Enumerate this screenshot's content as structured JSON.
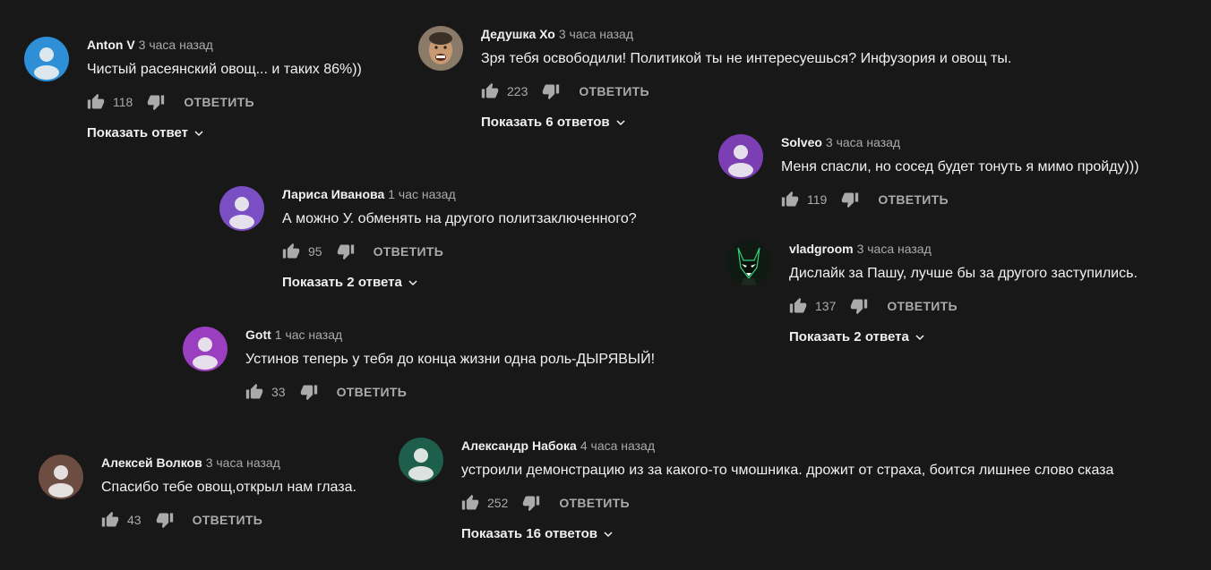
{
  "reply_label": "ОТВЕТИТЬ",
  "comments": [
    {
      "author": "Anton V",
      "time": "3 часа назад",
      "text": "Чистый расеянский овощ... и таких 86%))",
      "likes": "118",
      "show_replies": "Показать ответ",
      "avatar_icon": "person-icon",
      "avatar_color": "#2e8fd6"
    },
    {
      "author": "Дедушка Хо",
      "time": "3 часа назад",
      "text": "Зря тебя освободили! Политикой ты не интересуешься?  Инфузория и овощ ты.",
      "likes": "223",
      "show_replies": "Показать 6 ответов",
      "avatar_icon": "photo-avatar",
      "avatar_color": "#6b5a4a"
    },
    {
      "author": "Solveo",
      "time": "3 часа назад",
      "text": "Меня спасли, но сосед будет тонуть я мимо пройду)))",
      "likes": "119",
      "show_replies": "",
      "avatar_icon": "person-icon",
      "avatar_color": "#7b3fb3"
    },
    {
      "author": "Лариса Иванова",
      "time": "1 час назад",
      "text": "А можно У. обменять на другого политзаключенного?",
      "likes": "95",
      "show_replies": "Показать 2 ответа",
      "avatar_icon": "person-icon",
      "avatar_color": "#7a4fc4"
    },
    {
      "author": "vladgroom",
      "time": "3 часа назад",
      "text": "Дислайк за Пашу, лучше бы за другого заступились.",
      "likes": "137",
      "show_replies": "Показать 2 ответа",
      "avatar_icon": "fox-mask-avatar",
      "avatar_color": "#0e1a12"
    },
    {
      "author": "Gott",
      "time": "1 час назад",
      "text": "Устинов теперь у тебя до конца жизни одна роль-ДЫРЯВЫЙ!",
      "likes": "33",
      "show_replies": "",
      "avatar_icon": "person-icon",
      "avatar_color": "#9a3fbf"
    },
    {
      "author": "Алексей Волков",
      "time": "3 часа назад",
      "text": "Спасибо тебе овощ,открыл нам глаза.",
      "likes": "43",
      "show_replies": "",
      "avatar_icon": "person-icon",
      "avatar_color": "#6d4c41"
    },
    {
      "author": "Александр Набока",
      "time": "4 часа назад",
      "text": "устроили демонстрацию из за какого-то чмошника. дрожит от страха, боится лишнее слово сказа",
      "likes": "252",
      "show_replies": "Показать 16 ответов",
      "avatar_icon": "person-icon",
      "avatar_color": "#1e5f4b"
    }
  ]
}
